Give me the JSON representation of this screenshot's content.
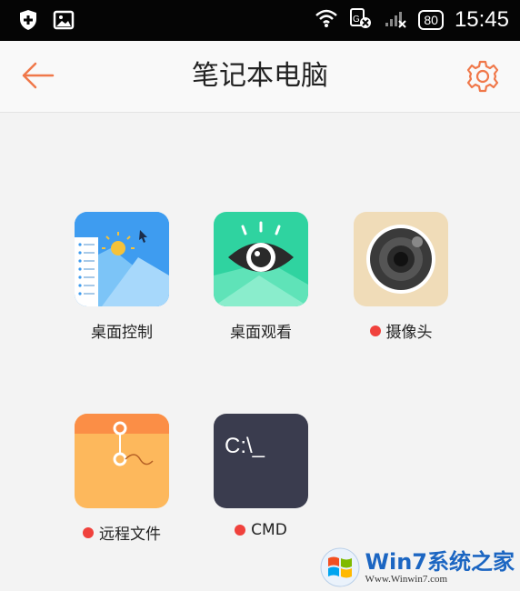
{
  "statusbar": {
    "time": "15:45",
    "battery": "80",
    "icons": [
      "shield-plus-icon",
      "image-icon",
      "wifi-icon",
      "data-off-icon",
      "signal-off-icon"
    ]
  },
  "header": {
    "title": "笔记本电脑",
    "back_icon": "back-arrow-icon",
    "settings_icon": "gear-icon",
    "accent": "#f0784a"
  },
  "apps": [
    {
      "label": "桌面控制",
      "icon": "desktop-control-icon",
      "dot": false
    },
    {
      "label": "桌面观看",
      "icon": "eye-icon",
      "dot": false
    },
    {
      "label": "摄像头",
      "icon": "camera-icon",
      "dot": true
    },
    {
      "label": "远程文件",
      "icon": "envelope-icon",
      "dot": true
    },
    {
      "label": "CMD",
      "icon": "terminal-icon",
      "dot": true,
      "terminal_text": "C:\\_"
    }
  ],
  "watermark": {
    "brand": "Win7系统之家",
    "url": "Www.Winwin7.com"
  }
}
